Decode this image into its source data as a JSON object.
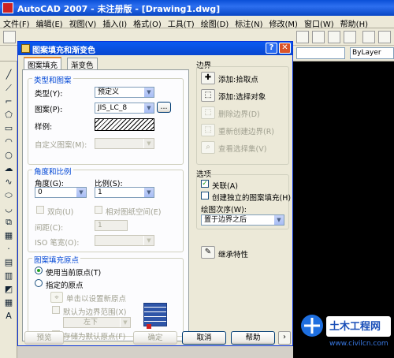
{
  "app": {
    "title": "AutoCAD 2007 - 未注册版 - [Drawing1.dwg]"
  },
  "menubar": {
    "items": [
      "文件(F)",
      "编辑(E)",
      "视图(V)",
      "插入(I)",
      "格式(O)",
      "工具(T)",
      "绘图(D)",
      "标注(N)",
      "修改(M)",
      "窗口(W)",
      "帮助(H)"
    ]
  },
  "layer": {
    "bylayer": "ByLayer"
  },
  "dialog": {
    "title": "图案填充和渐变色",
    "tabs": [
      "图案填充",
      "渐变色"
    ],
    "type_pattern": {
      "title": "类型和图案",
      "type_label": "类型(Y):",
      "type_value": "预定义",
      "pattern_label": "图案(P):",
      "pattern_value": "JIS_LC_8",
      "browse": "...",
      "sample_label": "样例:",
      "custom_label": "自定义图案(M):"
    },
    "angle_scale": {
      "title": "角度和比例",
      "angle_label": "角度(G):",
      "angle_value": "0",
      "scale_label": "比例(S):",
      "scale_value": "1",
      "double_label": "双向(U)",
      "relative_label": "相对图纸空间(E)",
      "spacing_label": "间距(C):",
      "spacing_value": "1",
      "iso_label": "ISO 笔宽(O):"
    },
    "origin": {
      "title": "图案填充原点",
      "use_current": "使用当前原点(T)",
      "specified": "指定的原点",
      "click_set": "单击以设置新原点",
      "default_extent": "默认为边界范围(X)",
      "extent_value": "左下",
      "store_default": "存储为默认原点(F)"
    },
    "boundaries": {
      "title": "边界",
      "add_pick": "添加:拾取点",
      "add_select": "添加:选择对象",
      "remove": "删除边界(D)",
      "recreate": "重新创建边界(R)",
      "view_sel": "查看选择集(V)"
    },
    "options": {
      "title": "选项",
      "associative": "关联(A)",
      "separate": "创建独立的图案填充(H)",
      "draw_order_label": "绘图次序(W):",
      "draw_order_value": "置于边界之后"
    },
    "inherit": "继承特性",
    "buttons": {
      "preview": "预览",
      "ok": "确定",
      "cancel": "取消",
      "help": "帮助"
    }
  }
}
